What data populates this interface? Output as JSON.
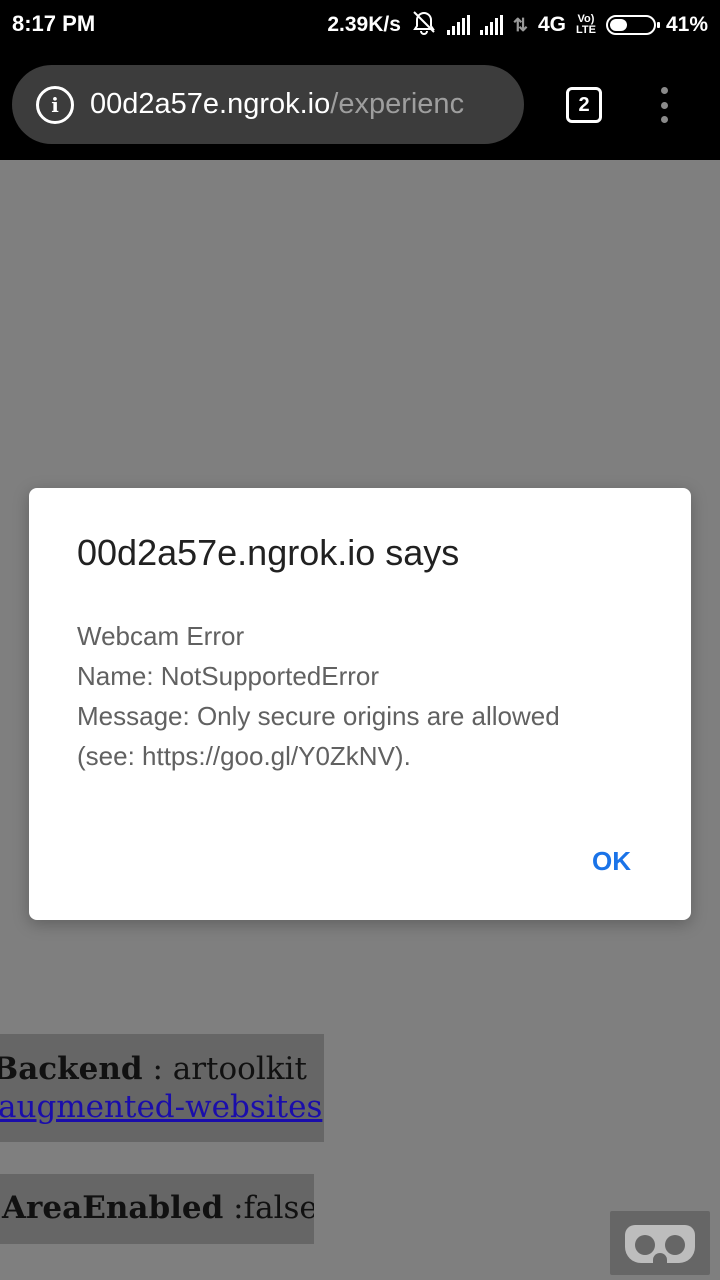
{
  "status_bar": {
    "time": "8:17 PM",
    "network_speed": "2.39K/s",
    "network_type": "4G",
    "volte_top": "Vo)",
    "volte_bottom": "LTE",
    "battery_percent": "41%",
    "battery_level": 0.41,
    "icons": [
      "alarm-off-icon",
      "signal-icon",
      "signal-icon",
      "data-arrows-icon",
      "volte-icon",
      "battery-icon"
    ]
  },
  "browser": {
    "url_host": "00d2a57e.ngrok.io",
    "url_path": "/experienc",
    "tab_count": "2",
    "icons": [
      "info-icon",
      "tabs-icon",
      "more-vert-icon"
    ]
  },
  "page": {
    "backend_label": "Backend",
    "backend_value": " : artoolkit",
    "link_text": "augmented-websites",
    "area_label": "AreaEnabled",
    "area_value": " :false",
    "vr_icon": "vr-goggles-icon"
  },
  "dialog": {
    "title": "00d2a57e.ngrok.io says",
    "lines": [
      "Webcam Error",
      "Name: NotSupportedError",
      "Message: Only secure origins are allowed",
      "(see: https://goo.gl/Y0ZkNV)."
    ],
    "ok_label": "OK",
    "accent_color": "#1a73e8"
  }
}
